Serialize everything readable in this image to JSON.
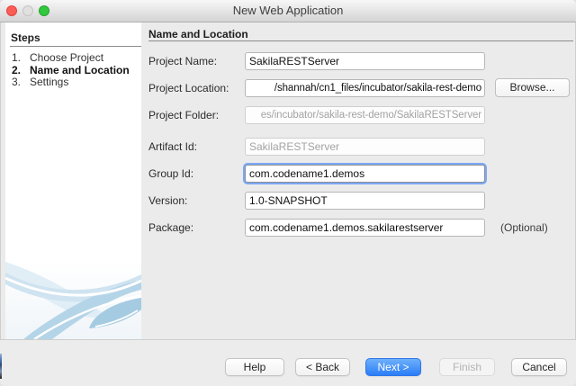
{
  "window": {
    "title": "New Web Application"
  },
  "sidebar": {
    "heading": "Steps",
    "steps": [
      {
        "num": "1.",
        "label": "Choose Project"
      },
      {
        "num": "2.",
        "label": "Name and Location"
      },
      {
        "num": "3.",
        "label": "Settings"
      }
    ]
  },
  "main": {
    "heading": "Name and Location",
    "fields": [
      {
        "label": "Project Name:",
        "value": "SakilaRESTServer",
        "state": "normal"
      },
      {
        "label": "Project Location:",
        "value": "/shannah/cn1_files/incubator/sakila-rest-demo",
        "state": "normal",
        "button": "Browse..."
      },
      {
        "label": "Project Folder:",
        "value": "es/incubator/sakila-rest-demo/SakilaRESTServer",
        "state": "disabled"
      },
      {
        "label": "Artifact Id:",
        "value": "SakilaRESTServer",
        "state": "disabled"
      },
      {
        "label": "Group Id:",
        "value": "com.codename1.demos",
        "state": "focused"
      },
      {
        "label": "Version:",
        "value": "1.0-SNAPSHOT",
        "state": "normal"
      },
      {
        "label": "Package:",
        "value": "com.codename1.demos.sakilarestserver",
        "state": "normal",
        "suffix": "(Optional)"
      }
    ]
  },
  "footer": {
    "buttons": [
      {
        "label": "Help",
        "type": "normal"
      },
      {
        "label": "< Back",
        "type": "normal"
      },
      {
        "label": "Next >",
        "type": "default"
      },
      {
        "label": "Finish",
        "type": "disabled"
      },
      {
        "label": "Cancel",
        "type": "normal"
      }
    ]
  },
  "colors": {
    "accent_blue": "#2b7df7",
    "focus_ring": "#7aa8f7",
    "traffic_red": "#fc5d57",
    "traffic_gray": "#e0e0e0",
    "traffic_green": "#32c83c",
    "swoosh_blue": "#bcd8ea"
  }
}
